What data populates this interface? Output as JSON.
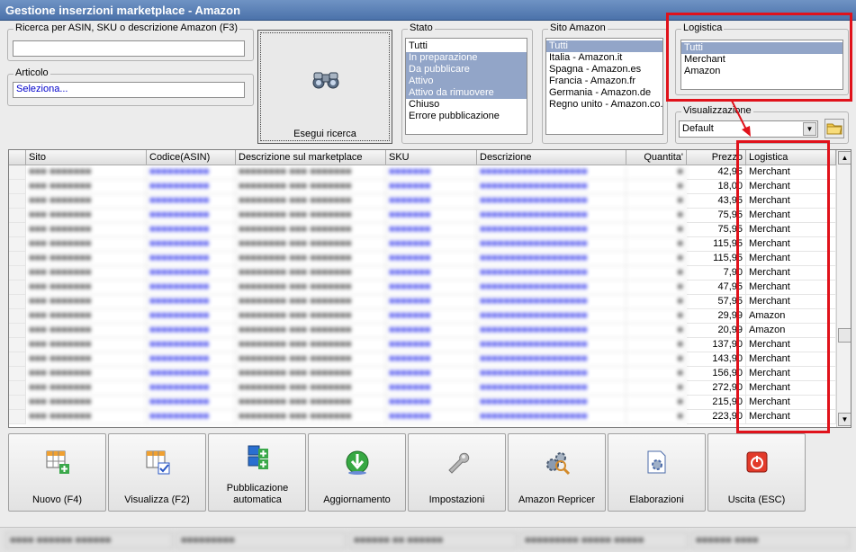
{
  "window": {
    "title": "Gestione inserzioni marketplace - Amazon"
  },
  "search": {
    "label": "Ricerca per ASIN, SKU o descrizione Amazon (F3)",
    "value": ""
  },
  "articolo": {
    "label": "Articolo",
    "value": "Seleziona..."
  },
  "search_button": {
    "label": "Esegui ricerca",
    "icon": "binoculars-icon"
  },
  "stato": {
    "label": "Stato",
    "items": [
      {
        "text": "Tutti",
        "selected": false
      },
      {
        "text": "In preparazione",
        "selected": true
      },
      {
        "text": "Da pubblicare",
        "selected": true
      },
      {
        "text": "Attivo",
        "selected": true
      },
      {
        "text": "Attivo da rimuovere",
        "selected": true
      },
      {
        "text": "Chiuso",
        "selected": false
      },
      {
        "text": "Errore pubblicazione",
        "selected": false
      }
    ]
  },
  "sito": {
    "label": "Sito Amazon",
    "items": [
      {
        "text": "Tutti",
        "selected": true
      },
      {
        "text": "Italia - Amazon.it",
        "selected": false
      },
      {
        "text": "Spagna - Amazon.es",
        "selected": false
      },
      {
        "text": "Francia - Amazon.fr",
        "selected": false
      },
      {
        "text": "Germania - Amazon.de",
        "selected": false
      },
      {
        "text": "Regno unito - Amazon.co.",
        "selected": false
      }
    ]
  },
  "logistica": {
    "label": "Logistica",
    "items": [
      {
        "text": "Tutti",
        "selected": true
      },
      {
        "text": "Merchant",
        "selected": false
      },
      {
        "text": "Amazon",
        "selected": false
      }
    ]
  },
  "visualizzazione": {
    "label": "Visualizzazione",
    "value": "Default"
  },
  "colors": {
    "highlight_red": "#e0121b",
    "selection": "#92a5c8",
    "blurred_blue": "#5559ee"
  },
  "table": {
    "columns": [
      "Sito",
      "Codice(ASIN)",
      "Descrizione sul marketplace",
      "SKU",
      "Descrizione",
      "Quantita'",
      "Prezzo",
      "Logistica"
    ],
    "rows": [
      {
        "prezzo": "42,95",
        "logistica": "Merchant"
      },
      {
        "prezzo": "18,00",
        "logistica": "Merchant"
      },
      {
        "prezzo": "43,95",
        "logistica": "Merchant"
      },
      {
        "prezzo": "75,95",
        "logistica": "Merchant"
      },
      {
        "prezzo": "75,95",
        "logistica": "Merchant"
      },
      {
        "prezzo": "115,95",
        "logistica": "Merchant"
      },
      {
        "prezzo": "115,95",
        "logistica": "Merchant"
      },
      {
        "prezzo": "7,90",
        "logistica": "Merchant"
      },
      {
        "prezzo": "47,95",
        "logistica": "Merchant"
      },
      {
        "prezzo": "57,95",
        "logistica": "Merchant"
      },
      {
        "prezzo": "29,99",
        "logistica": "Amazon"
      },
      {
        "prezzo": "20,99",
        "logistica": "Amazon"
      },
      {
        "prezzo": "137,90",
        "logistica": "Merchant"
      },
      {
        "prezzo": "143,90",
        "logistica": "Merchant"
      },
      {
        "prezzo": "156,90",
        "logistica": "Merchant"
      },
      {
        "prezzo": "272,90",
        "logistica": "Merchant"
      },
      {
        "prezzo": "215,90",
        "logistica": "Merchant"
      },
      {
        "prezzo": "223,90",
        "logistica": "Merchant"
      }
    ]
  },
  "toolbar": [
    {
      "label": "Nuovo (F4)",
      "icon": "grid-add-icon"
    },
    {
      "label": "Visualizza (F2)",
      "icon": "grid-check-icon"
    },
    {
      "label": "Pubblicazione automatica",
      "icon": "puzzle-add-icon"
    },
    {
      "label": "Aggiornamento",
      "icon": "globe-download-icon"
    },
    {
      "label": "Impostazioni",
      "icon": "wrench-icon"
    },
    {
      "label": "Amazon Repricer",
      "icon": "gears-magnifier-icon"
    },
    {
      "label": "Elaborazioni",
      "icon": "document-gear-icon"
    },
    {
      "label": "Uscita (ESC)",
      "icon": "power-icon"
    }
  ]
}
